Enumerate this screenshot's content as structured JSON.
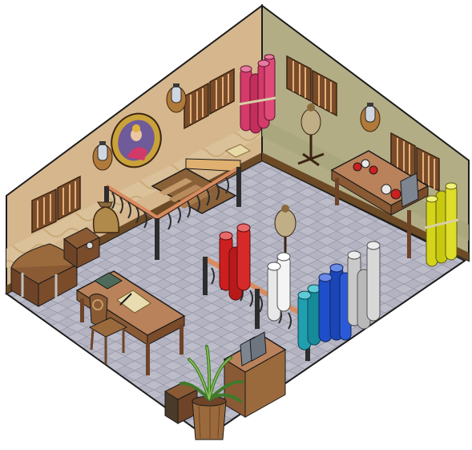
{
  "scene": {
    "kind": "isometric-room",
    "colors": {
      "floor": "#b9b9c6",
      "floor_grid": "#8f8fa0",
      "left_wall": "#d9b98c",
      "right_wall": "#b7b088",
      "wall_dark": "#8a6a3c",
      "trim": "#6b4a25",
      "wood": "#a9744a",
      "wood_dark": "#6e4327",
      "railing": "#2d2d2d",
      "rail_cap": "#d98b5e",
      "outline": "#1c1c1c"
    },
    "fabric_rolls": [
      {
        "color": "#d43a6a",
        "group": "magenta"
      },
      {
        "color": "#cc1f1f",
        "group": "red"
      },
      {
        "color": "#e8e8e8",
        "group": "white"
      },
      {
        "color": "#1f9fb0",
        "group": "teal"
      },
      {
        "color": "#1f4fc8",
        "group": "blue"
      },
      {
        "color": "#c9c9c9",
        "group": "grey"
      },
      {
        "color": "#d4d41a",
        "group": "yellow"
      }
    ],
    "icons": [
      "wall-lamp-icon",
      "portrait-icon",
      "window-icon",
      "mannequin-icon",
      "treasure-chest-icon",
      "potted-palm-icon",
      "money-sack-icon",
      "chair-icon",
      "desk-icon",
      "counter-icon",
      "staircase-icon"
    ]
  }
}
